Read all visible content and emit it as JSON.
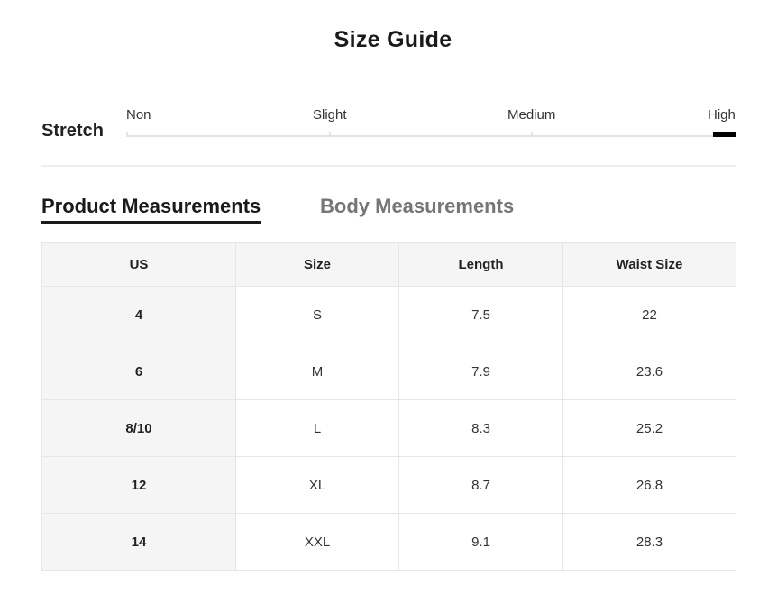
{
  "title": "Size Guide",
  "stretch": {
    "label": "Stretch",
    "levels": [
      "Non",
      "Slight",
      "Medium",
      "High"
    ],
    "selected": "High"
  },
  "tabs": [
    {
      "label": "Product Measurements",
      "active": true
    },
    {
      "label": "Body Measurements",
      "active": false
    }
  ],
  "table": {
    "headers": [
      "US",
      "Size",
      "Length",
      "Waist Size"
    ],
    "rows": [
      [
        "4",
        "S",
        "7.5",
        "22"
      ],
      [
        "6",
        "M",
        "7.9",
        "23.6"
      ],
      [
        "8/10",
        "L",
        "8.3",
        "25.2"
      ],
      [
        "12",
        "XL",
        "8.7",
        "26.8"
      ],
      [
        "14",
        "XXL",
        "9.1",
        "28.3"
      ]
    ]
  }
}
